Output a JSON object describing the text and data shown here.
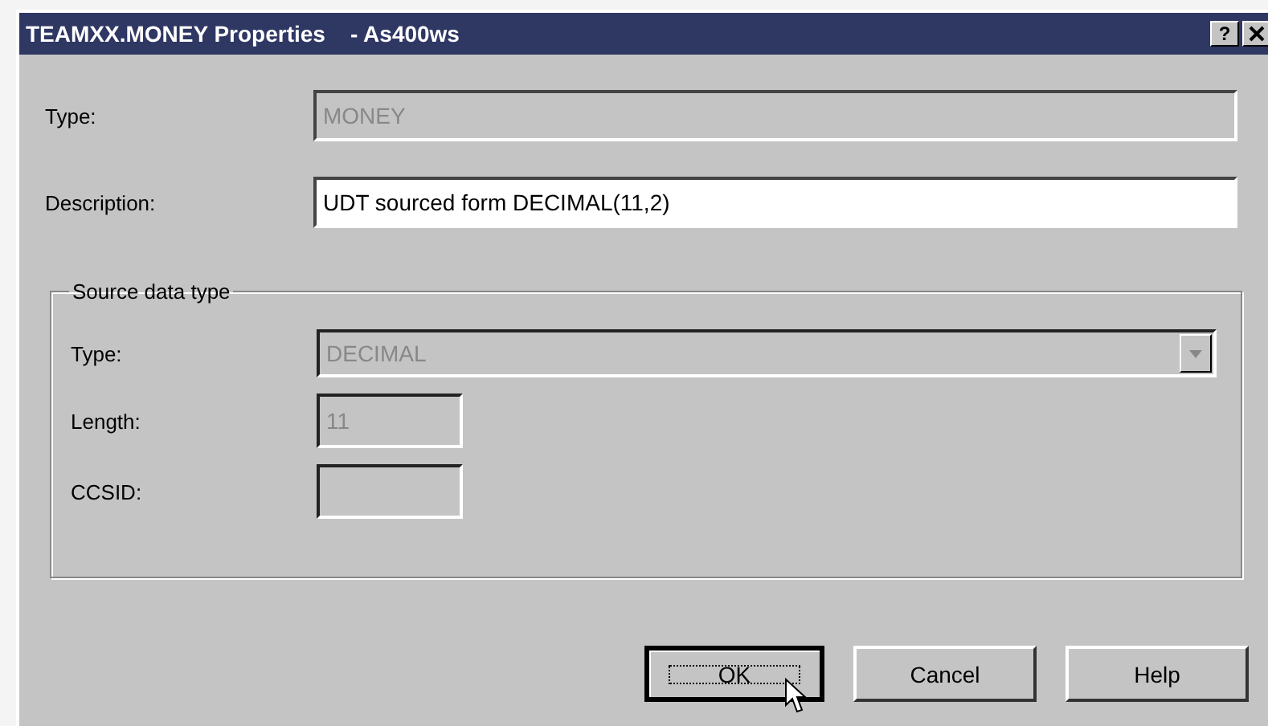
{
  "window": {
    "title": "TEAMXX.MONEY Properties    - As400ws",
    "help_button": "?"
  },
  "fields": [
    {
      "label": "Type:",
      "value": "MONEY",
      "disabled": true
    },
    {
      "label": "Description:",
      "value": "UDT sourced form DECIMAL(11,2)",
      "disabled": false
    }
  ],
  "group": {
    "legend": "Source data type",
    "fields": [
      {
        "kind": "dropdown",
        "label": "Type:",
        "value": "DECIMAL",
        "disabled": true
      },
      {
        "kind": "text",
        "label": "Length:",
        "value": "11",
        "disabled": true
      },
      {
        "kind": "text",
        "label": "CCSID:",
        "disabled": true
      }
    ]
  },
  "buttons": [
    {
      "label": "OK",
      "default": true
    },
    {
      "label": "Cancel",
      "default": false
    },
    {
      "label": "Help",
      "default": false
    }
  ]
}
